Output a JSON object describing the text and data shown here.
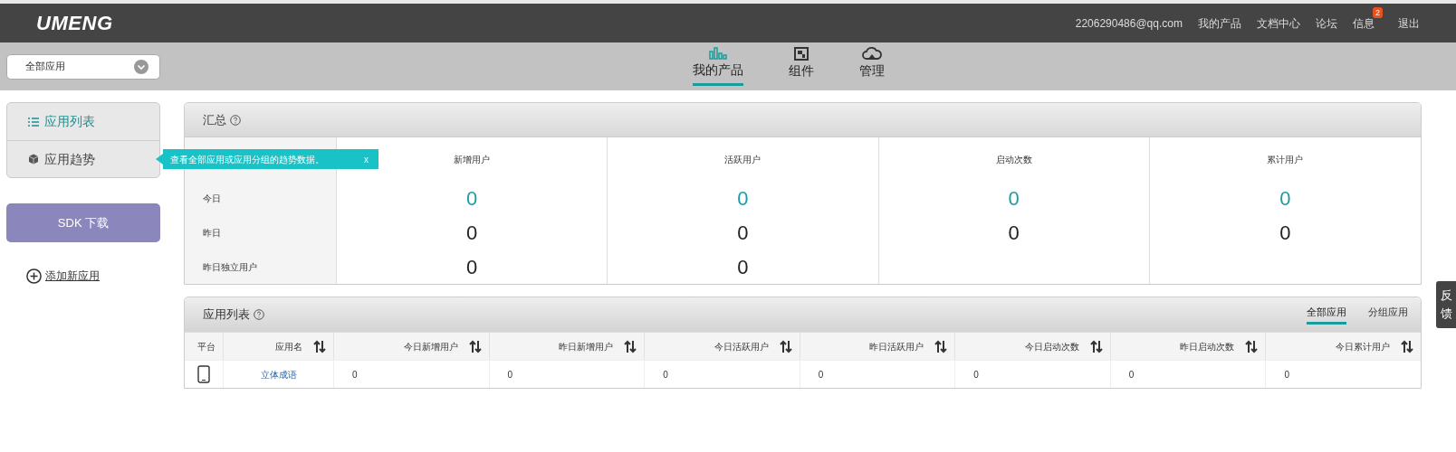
{
  "header": {
    "logo": "UMENG",
    "links": [
      {
        "label": "2206290486@qq.com"
      },
      {
        "label": "我的产品"
      },
      {
        "label": "文档中心"
      },
      {
        "label": "论坛"
      },
      {
        "label": "信息",
        "badge": "2"
      },
      {
        "label": "退出"
      }
    ]
  },
  "app_select": {
    "value": "全部应用"
  },
  "nav_tabs": [
    {
      "label": "我的产品",
      "selected": true,
      "kind": "chart"
    },
    {
      "label": "组件",
      "selected": false,
      "kind": "widget"
    },
    {
      "label": "管理",
      "selected": false,
      "kind": "cloud"
    }
  ],
  "sidebar": {
    "items": [
      {
        "label": "应用列表",
        "selected": true,
        "kind": "list"
      },
      {
        "label": "应用趋势",
        "selected": false,
        "kind": "cube"
      }
    ],
    "tooltip": {
      "text": "查看全部应用或应用分组的趋势数据。",
      "close": "x"
    },
    "sdk_button": "SDK 下载",
    "add_link": "添加新应用"
  },
  "summary": {
    "title": "汇总",
    "columns": [
      "新增用户",
      "活跃用户",
      "启动次数",
      "累计用户"
    ],
    "rows": [
      {
        "label": "今日",
        "highlight": true,
        "values": [
          "0",
          "0",
          "0",
          "0"
        ]
      },
      {
        "label": "昨日",
        "highlight": false,
        "values": [
          "0",
          "0",
          "0",
          "0"
        ]
      },
      {
        "label": "昨日独立用户",
        "highlight": false,
        "values": [
          "0",
          "0"
        ]
      }
    ]
  },
  "app_list": {
    "title": "应用列表",
    "filters": [
      {
        "label": "全部应用",
        "selected": true
      },
      {
        "label": "分组应用",
        "selected": false
      }
    ],
    "columns": [
      {
        "label": "平台",
        "sortable": false
      },
      {
        "label": "应用名",
        "sortable": true
      },
      {
        "label": "今日新增用户",
        "sortable": true
      },
      {
        "label": "昨日新增用户",
        "sortable": true
      },
      {
        "label": "今日活跃用户",
        "sortable": true
      },
      {
        "label": "昨日活跃用户",
        "sortable": true
      },
      {
        "label": "今日启动次数",
        "sortable": true
      },
      {
        "label": "昨日启动次数",
        "sortable": true
      },
      {
        "label": "今日累计用户",
        "sortable": true
      }
    ],
    "rows": [
      {
        "kind": "phone",
        "name": "立体成语",
        "values": [
          "0",
          "0",
          "0",
          "0",
          "0",
          "0",
          "0"
        ]
      }
    ]
  },
  "feedback": "反馈"
}
